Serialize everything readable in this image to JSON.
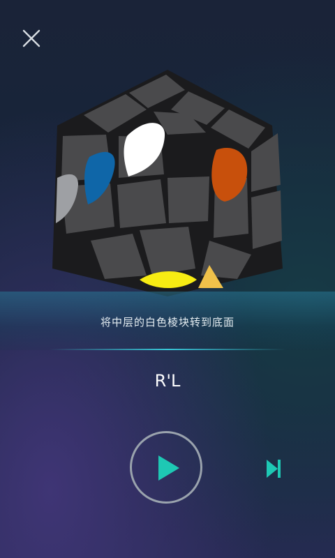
{
  "header": {
    "close_icon": "close-icon"
  },
  "cube": {
    "sticker_colors": {
      "white": "#ffffff",
      "blue": "#0f66a8",
      "orange": "#c8500c",
      "gray": "#9ea0a4",
      "yellow": "#f7ec13"
    },
    "direction_marker": "arrow-triangle-icon"
  },
  "instruction": {
    "text": "将中层的白色棱块转到底面"
  },
  "move": {
    "notation": "R'L"
  },
  "controls": {
    "play_icon": "play-icon",
    "skip_icon": "skip-next-icon",
    "accent": "#1ec8b4"
  }
}
